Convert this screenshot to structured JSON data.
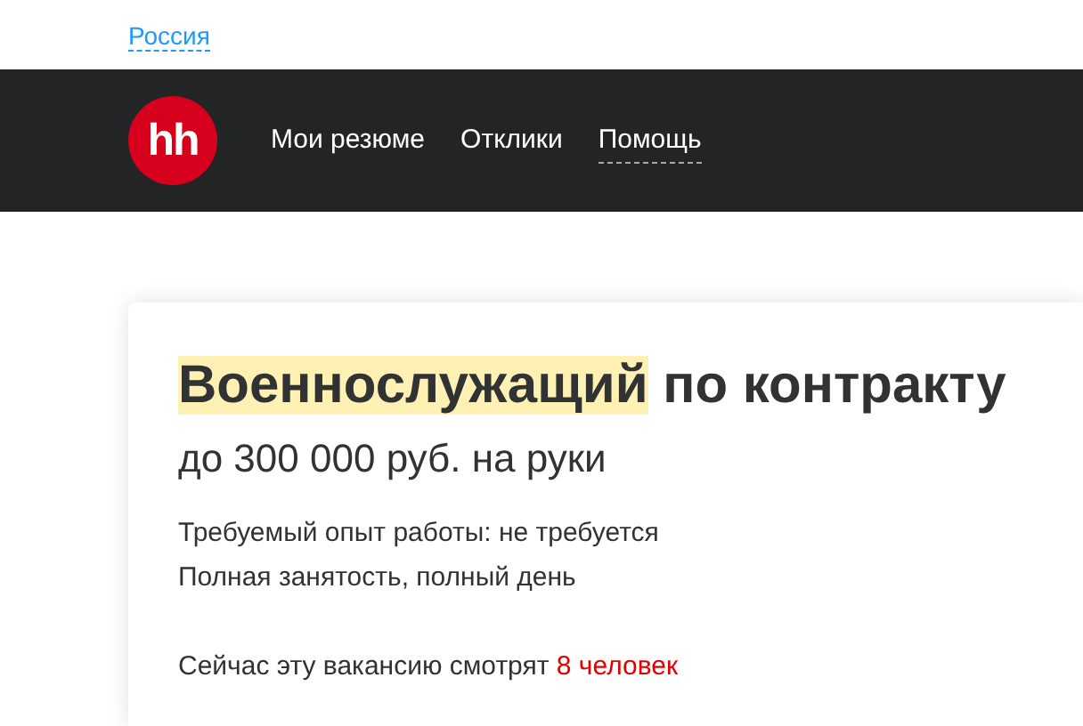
{
  "region_link": "Россия",
  "logo": {
    "text": "hh"
  },
  "nav": [
    {
      "label": "Мои резюме",
      "selected": false
    },
    {
      "label": "Отклики",
      "selected": false
    },
    {
      "label": "Помощь",
      "selected": true
    }
  ],
  "vacancy": {
    "title": [
      {
        "text": "Военнослужащий",
        "highlighted": true
      },
      {
        "text": " по контракту",
        "highlighted": false
      }
    ],
    "salary": "до 300 000 руб. на руки",
    "experience": "Требуемый опыт работы: не требуется",
    "employment": "Полная занятость, полный день",
    "viewers": [
      {
        "text": "Сейчас эту вакансию смотрят ",
        "accent": false
      },
      {
        "text": "8 человек",
        "accent": true
      }
    ]
  }
}
